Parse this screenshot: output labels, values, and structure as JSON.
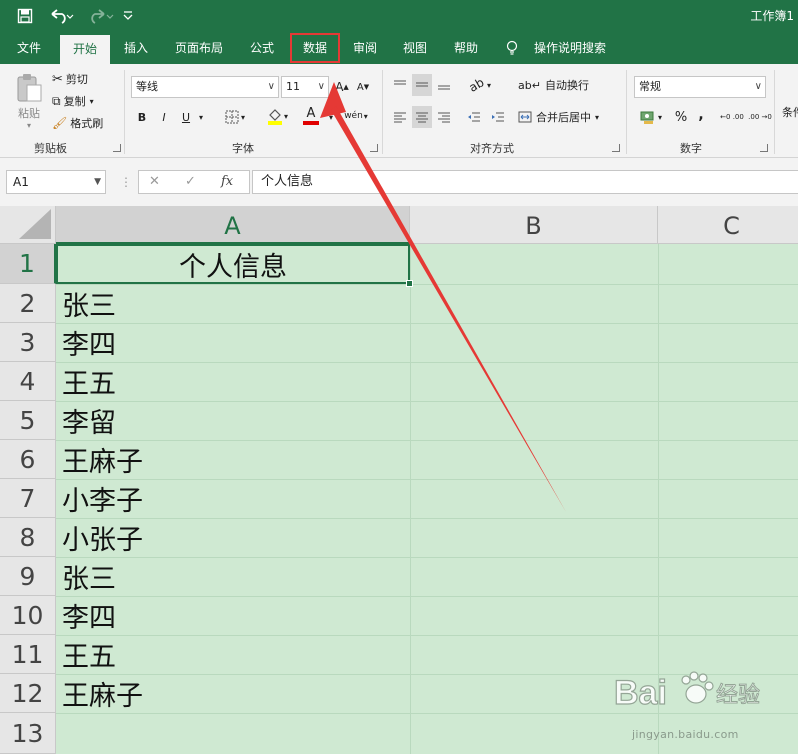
{
  "titlebar": {
    "doc_title": "工作簿1",
    "icons": [
      "save-icon",
      "undo-icon",
      "redo-icon",
      "customize-quick-access-icon"
    ]
  },
  "tabs": [
    {
      "label": "文件"
    },
    {
      "label": "开始"
    },
    {
      "label": "插入"
    },
    {
      "label": "页面布局"
    },
    {
      "label": "公式"
    },
    {
      "label": "数据"
    },
    {
      "label": "审阅"
    },
    {
      "label": "视图"
    },
    {
      "label": "帮助"
    },
    {
      "label": "操作说明搜索"
    }
  ],
  "ribbon": {
    "clipboard": {
      "paste_label": "粘贴",
      "cut_label": "剪切",
      "copy_label": "复制",
      "format_painter_label": "格式刷",
      "group_label": "剪贴板"
    },
    "font": {
      "font_name": "等线",
      "font_size": "11",
      "bold": "B",
      "italic": "I",
      "underline": "U",
      "increase_size": "A",
      "decrease_size": "A",
      "font_color_letter": "A",
      "phonetic": "wén",
      "group_label": "字体"
    },
    "alignment": {
      "wrap_text_label": "自动换行",
      "merge_center_label": "合并后居中",
      "group_label": "对齐方式"
    },
    "number": {
      "format": "常规",
      "percent": "%",
      "comma": ",",
      "increase_decimal": "←0 .00",
      "decrease_decimal": ".00 →0",
      "group_label": "数字"
    },
    "styles": {
      "conditional_label": "条件"
    }
  },
  "formula_bar": {
    "name_box": "A1",
    "cancel": "✕",
    "enter": "✓",
    "fx": "fx",
    "content": "个人信息"
  },
  "grid": {
    "columns": [
      "A",
      "B",
      "C"
    ],
    "rows": [
      "1",
      "2",
      "3",
      "4",
      "5",
      "6",
      "7",
      "8",
      "9",
      "10",
      "11",
      "12",
      "13"
    ],
    "cells": {
      "A1": "个人信息",
      "A": [
        "张三",
        "李四",
        "王五",
        "李留",
        "王麻子",
        "小李子",
        "小张子",
        "张三",
        "李四",
        "王五",
        "王麻子"
      ]
    }
  },
  "annotation": {
    "highlighted_tab": "数据",
    "arrow_color": "#e53935"
  },
  "watermark": {
    "logo_text": "Bai",
    "logo_text2": "经验",
    "url": "jingyan.baidu.com"
  },
  "colors": {
    "excel_green": "#217346",
    "selection_fill": "#cfe9d2",
    "header_bg": "#e6e6e6"
  }
}
